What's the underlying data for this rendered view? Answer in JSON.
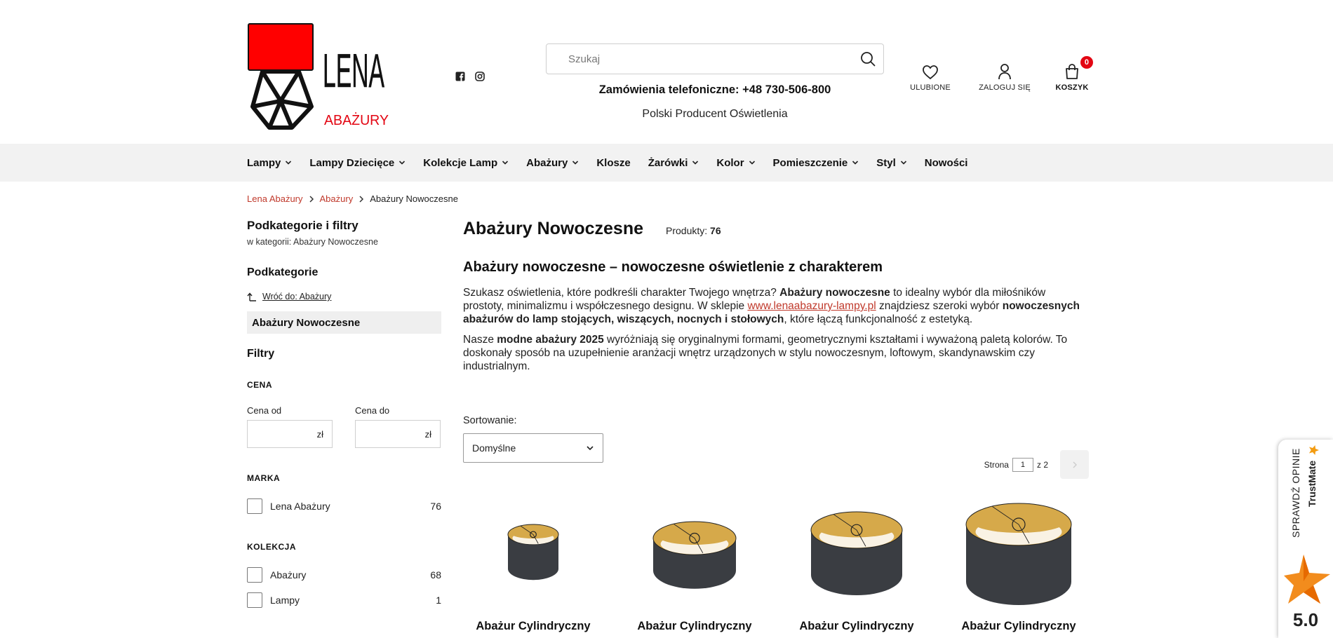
{
  "logo": {
    "brand": "LENA",
    "sub": "ABAŻURY"
  },
  "social": {
    "facebook_icon": "facebook-icon",
    "instagram_icon": "instagram-icon"
  },
  "search": {
    "placeholder": "Szukaj",
    "icon": "search-icon"
  },
  "header": {
    "phone": "Zamówienia telefoniczne: +48 730-506-800",
    "producer": "Polski Producent Oświetlenia",
    "favorites_label": "ULUBIONE",
    "login_label": "ZALOGUJ SIĘ",
    "cart_label": "KOSZYK",
    "cart_count": "0"
  },
  "nav": {
    "items": [
      {
        "label": "Lampy",
        "has_dropdown": true
      },
      {
        "label": "Lampy Dziecięce",
        "has_dropdown": true
      },
      {
        "label": "Kolekcje Lamp",
        "has_dropdown": true
      },
      {
        "label": "Abażury",
        "has_dropdown": true
      },
      {
        "label": "Klosze",
        "has_dropdown": false
      },
      {
        "label": "Żarówki",
        "has_dropdown": true
      },
      {
        "label": "Kolor",
        "has_dropdown": true
      },
      {
        "label": "Pomieszczenie",
        "has_dropdown": true
      },
      {
        "label": "Styl",
        "has_dropdown": true
      },
      {
        "label": "Nowości",
        "has_dropdown": false
      }
    ]
  },
  "breadcrumb": {
    "home": "Lena Abażury",
    "parent": "Abażury",
    "current": "Abażury Nowoczesne"
  },
  "sidebar": {
    "title": "Podkategorie i filtry",
    "subtitle": "w kategorii: Abażury Nowoczesne",
    "subcategories_title": "Podkategorie",
    "back_label": "Wróć do: Abażury",
    "active_category": "Abażury Nowoczesne",
    "filters_title": "Filtry",
    "price": {
      "title": "CENA",
      "from_label": "Cena od",
      "to_label": "Cena do",
      "currency": "zł"
    },
    "brand": {
      "title": "MARKA",
      "options": [
        {
          "label": "Lena Abażury",
          "count": "76"
        }
      ]
    },
    "collection": {
      "title": "KOLEKCJA",
      "options": [
        {
          "label": "Abażury",
          "count": "68"
        },
        {
          "label": "Lampy",
          "count": "1"
        }
      ]
    }
  },
  "main": {
    "title": "Abażury Nowoczesne",
    "products_label": "Produkty:",
    "products_count": "76",
    "heading": "Abażury nowoczesne – nowoczesne oświetlenie z charakterem",
    "p1": {
      "a": "Szukasz oświetlenia, które podkreśli charakter Twojego wnętrza? ",
      "b": "Abażury nowoczesne",
      "c": " to idealny wybór dla miłośników prostoty, minimalizmu i współczesnego designu. W sklepie ",
      "link": "www.lenaabazury-lampy.pl",
      "d": " znajdziesz szeroki wybór ",
      "e": "nowoczesnych abażurów do lamp stojących, wiszących, nocnych i stołowych",
      "f": ", które łączą funkcjonalność z estetyką."
    },
    "p2": {
      "a": "Nasze ",
      "b": "modne abażury 2025",
      "c": " wyróżniają się oryginalnymi formami, geometrycznymi kształtami i wyważoną paletą kolorów. To doskonały sposób na uzupełnienie aranżacji wnętrz urządzonych w stylu nowoczesnym, loftowym, skandynawskim czy industrialnym."
    },
    "sort_label": "Sortowanie:",
    "sort_value": "Domyślne",
    "pager": {
      "page_label": "Strona",
      "current": "1",
      "of_label": "z 2"
    }
  },
  "products": [
    {
      "name": "Abażur Cylindryczny"
    },
    {
      "name": "Abażur Cylindryczny"
    },
    {
      "name": "Abażur Cylindryczny"
    },
    {
      "name": "Abażur Cylindryczny"
    }
  ],
  "trustmate": {
    "label": "SPRAWDŹ OPINIE",
    "brand": "TrustMate",
    "score": "5.0"
  },
  "colors": {
    "accent": "#e30613",
    "link": "#c0392b",
    "nav_bg": "#f2f2f2",
    "gold": "#d6a94a",
    "shade": "#3a3d42"
  }
}
